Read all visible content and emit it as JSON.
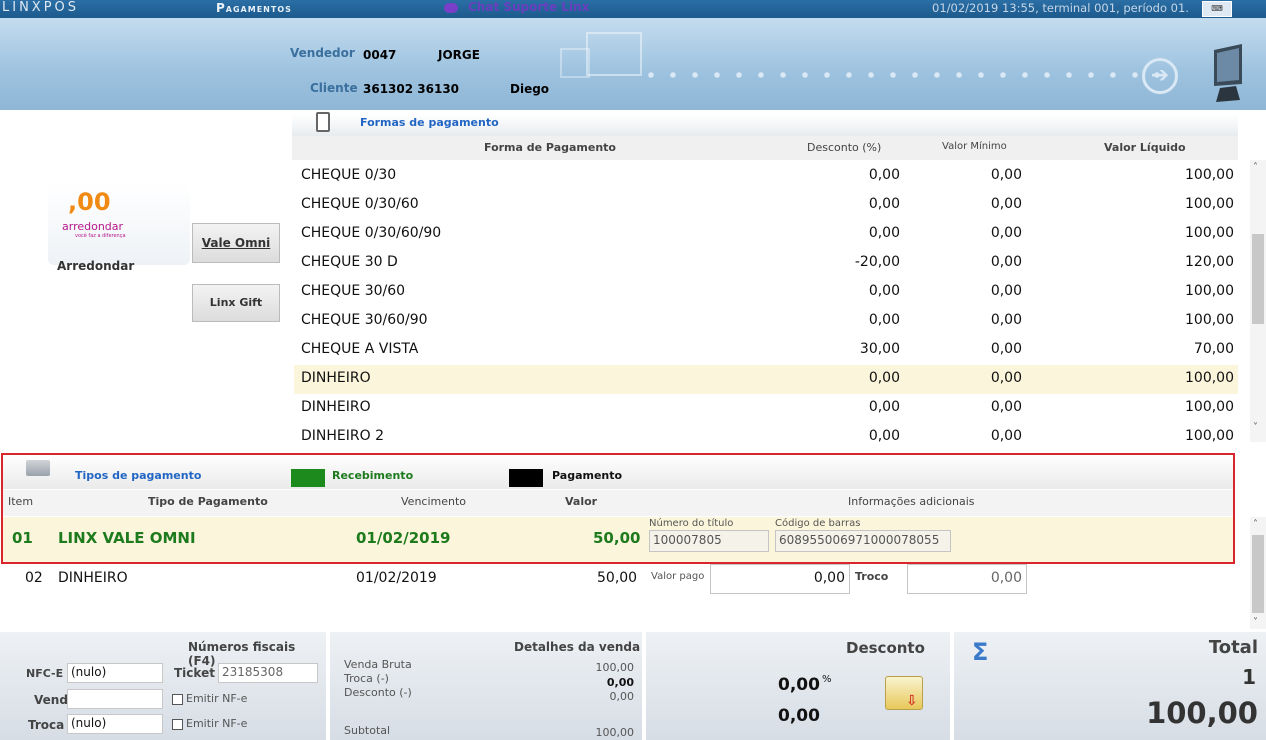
{
  "topbar": {
    "brand": "LINXPOS",
    "title": "Pagamentos",
    "chat": "Chat Suporte Linx",
    "status": "01/02/2019 13:55, terminal 001, período 01."
  },
  "header": {
    "vendedor_label": "Vendedor",
    "vendedor_code": "0047",
    "vendedor_name": "JORGE",
    "cliente_label": "Cliente",
    "cliente_code": "361302 36130",
    "cliente_name": "Diego"
  },
  "left": {
    "logo": ",00",
    "logo_text": "arredondar",
    "logo_sub": "você faz a diferença",
    "arredondar": "Arredondar",
    "vale_omni": "Vale Omni",
    "linx_gift": "Linx Gift"
  },
  "forms": {
    "title": "Formas de pagamento",
    "columns": [
      "Forma de Pagamento",
      "Desconto (%)",
      "Valor Mínimo",
      "Valor Líquido"
    ],
    "rows": [
      [
        "CHEQUE 0/30",
        "0,00",
        "0,00",
        "100,00"
      ],
      [
        "CHEQUE 0/30/60",
        "0,00",
        "0,00",
        "100,00"
      ],
      [
        "CHEQUE 0/30/60/90",
        "0,00",
        "0,00",
        "100,00"
      ],
      [
        "CHEQUE 30 D",
        "-20,00",
        "0,00",
        "120,00"
      ],
      [
        "CHEQUE 30/60",
        "0,00",
        "0,00",
        "100,00"
      ],
      [
        "CHEQUE 30/60/90",
        "0,00",
        "0,00",
        "100,00"
      ],
      [
        "CHEQUE A VISTA",
        "30,00",
        "0,00",
        "70,00"
      ],
      [
        "DINHEIRO",
        "0,00",
        "0,00",
        "100,00"
      ],
      [
        "DINHEIRO",
        "0,00",
        "0,00",
        "100,00"
      ],
      [
        "DINHEIRO 2",
        "0,00",
        "0,00",
        "100,00"
      ]
    ],
    "selected_row": 7,
    "colors": {
      "selected": "#fbf5dc"
    }
  },
  "tipos": {
    "title": "Tipos de pagamento",
    "recebimento": "Recebimento",
    "pagamento": "Pagamento",
    "columns": {
      "item": "Item",
      "tipo": "Tipo de Pagamento",
      "venc": "Vencimento",
      "valor": "Valor",
      "info": "Informações adicionais"
    },
    "row1": {
      "item": "01",
      "tipo": "LINX VALE OMNI",
      "venc": "01/02/2019",
      "valor": "50,00",
      "num_label": "Número do título",
      "num_value": "100007805",
      "cod_label": "Código de barras",
      "cod_value": "608955006971000078055"
    },
    "row2": {
      "item": "02",
      "tipo": "DINHEIRO",
      "venc": "01/02/2019",
      "valor": "50,00",
      "pago_label": "Valor pago",
      "pago_value": "0,00",
      "troco_label": "Troco",
      "troco_value": "0,00"
    },
    "colors": {
      "recebimento": "#1d8a1d",
      "pagamento": "#000000",
      "highlight_border": "#d9262c"
    }
  },
  "fiscal": {
    "title": "Números fiscais (F4)",
    "nfce_label": "NFC-E",
    "nfce_value": "(nulo)",
    "ticket_label": "Ticket",
    "ticket_value": "23185308",
    "venda_label": "Venda",
    "venda_value": "",
    "emitir1": "Emitir NF-e",
    "troca_label": "Troca",
    "troca_value": "(nulo)",
    "emitir2": "Emitir NF-e"
  },
  "detalhes": {
    "title": "Detalhes da venda",
    "bruta_label": "Venda Bruta",
    "bruta_value": "100,00",
    "troca_label": "Troca (-)",
    "troca_value": "0,00",
    "desc_label": "Desconto (-)",
    "desc_value": "0,00",
    "subtotal_label": "Subtotal",
    "subtotal_value": "100,00"
  },
  "desconto": {
    "title": "Desconto",
    "pct": "0,00",
    "pct_sym": "%",
    "valor": "0,00"
  },
  "total": {
    "title": "Total",
    "qty": "1",
    "value": "100,00",
    "sigma": "Σ"
  }
}
